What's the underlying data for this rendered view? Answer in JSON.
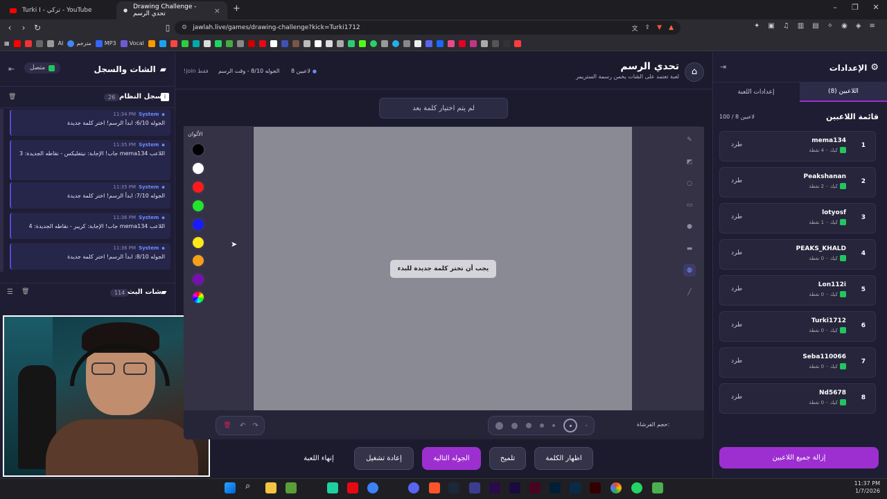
{
  "browser": {
    "tabs": [
      {
        "label": "Turki I - تركي - YouTube"
      },
      {
        "label": "Drawing Challenge - تحدي الرسم"
      }
    ],
    "url": "jawlah.live/games/drawing-challenge?kick=Turki1712",
    "bookmarks": [
      "AI",
      "مترجم",
      "MP3",
      "Vocal"
    ]
  },
  "left": {
    "title": "الشات والسجل",
    "status": "متصل",
    "system_log_title": "سجل النظام",
    "system_log_count": "26",
    "messages": [
      {
        "sender": "System",
        "time": "11:34 PM",
        "text": "الجوله 6/10: ابدأ الرسم! اختر كلمة جديدة"
      },
      {
        "sender": "System",
        "time": "11:35 PM",
        "text": "اللاعب mema134 جاب! الإجابة: نيتفليكس - نقاطه الجديدة: 3"
      },
      {
        "sender": "System",
        "time": "11:35 PM",
        "text": "الجوله 7/10: ابدأ الرسم! اختر كلمة جديدة"
      },
      {
        "sender": "System",
        "time": "11:36 PM",
        "text": "اللاعب mema134 جاب! الإجابة: كريبر - نقاطه الجديدة: 4"
      },
      {
        "sender": "System",
        "time": "11:36 PM",
        "text": "الجوله 8/10: ابدأ الرسم! اختر كلمة جديدة"
      }
    ],
    "live_chat_title": "شات البث",
    "live_chat_count": "114"
  },
  "center": {
    "title": "تحدي الرسم",
    "subtitle": "لعبة تعتمد على الشات يخمن رسمة الستريمر",
    "players_count": "8 لاعبين",
    "round_info": "الجوله 8/10 - وقت الرسم",
    "join_hint": "!join فقط",
    "word_status": "لم يتم اختيار كلمة بعد",
    "colors_label": "الألوان",
    "colors": [
      "#000000",
      "#ffffff",
      "#ff1a1a",
      "#22e52a",
      "#1a1aff",
      "#ffe81a",
      "#f5a018",
      "#7a0fb0"
    ],
    "canvas_message": "يجب أن تختر كلمة جديدة للبدء",
    "brush_size_label": "حجم الفرشاة:",
    "buttons": {
      "reveal": "اظهار الكلمة",
      "hint": "تلميح",
      "next_round": "الجوله التالية",
      "restart": "إعادة تشغيل",
      "end": "إنهاء اللعبة"
    }
  },
  "right": {
    "title": "الإعدادات",
    "tab_players": "اللاعبين (8)",
    "tab_settings": "إعدادات اللعبة",
    "list_title": "قائمة اللاعبين",
    "capacity": "100 / 8 لاعبين",
    "kick_label": "طرد",
    "players": [
      {
        "rank": "1",
        "name": "mema134",
        "points": "4 نقطة",
        "platform": "كيك"
      },
      {
        "rank": "2",
        "name": "Peakshanan",
        "points": "2 نقطة",
        "platform": "كيك"
      },
      {
        "rank": "3",
        "name": "lotyosf",
        "points": "1 نقطة",
        "platform": "كيك"
      },
      {
        "rank": "4",
        "name": "PEAKS_KHALD",
        "points": "0 نقطة",
        "platform": "كيك"
      },
      {
        "rank": "5",
        "name": "Lon112i",
        "points": "0 نقطة",
        "platform": "كيك"
      },
      {
        "rank": "6",
        "name": "Turki1712",
        "points": "0 نقطة",
        "platform": "كيك"
      },
      {
        "rank": "7",
        "name": "Seba110066",
        "points": "0 نقطة",
        "platform": "كيك"
      },
      {
        "rank": "8",
        "name": "Nd5678",
        "points": "0 نقطة",
        "platform": "كيك"
      }
    ],
    "remove_all": "إزالة جميع اللاعبين"
  },
  "taskbar": {
    "time": "11:37 PM",
    "date": "1/7/2026"
  }
}
